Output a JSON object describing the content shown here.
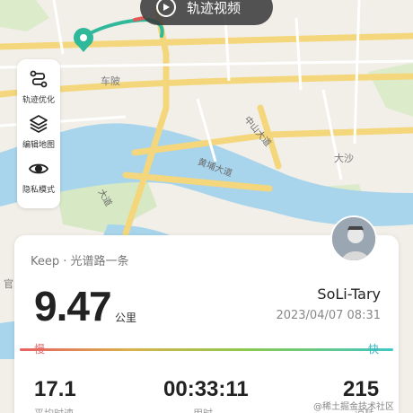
{
  "video_button": {
    "label": "轨迹视频",
    "icon": "play-icon"
  },
  "tools": [
    {
      "label": "轨迹优化",
      "icon": "route-optimize-icon"
    },
    {
      "label": "编辑地图",
      "icon": "layers-icon"
    },
    {
      "label": "隐私模式",
      "icon": "eye-icon"
    }
  ],
  "map": {
    "labels": {
      "chebei": "车陂",
      "dasha": "大沙",
      "huangpu_avenue": "黄埔大道",
      "zhongshan_avenue": "中山大道",
      "guan": "官",
      "misc_road": "大道"
    },
    "route_color": "#2fb89a"
  },
  "card": {
    "source": "Keep · 光谱路一条",
    "distance": "9.47",
    "distance_unit": "公里",
    "username": "SoLi-Tary",
    "datetime": "2023/04/07 08:31",
    "speed_slow": "慢",
    "speed_fast": "快",
    "stats": [
      {
        "value": "17.1",
        "label": "平均时速"
      },
      {
        "value": "00:33:11",
        "label": "用时"
      },
      {
        "value": "215",
        "label": "消耗"
      }
    ]
  },
  "watermark": "@稀土掘金技术社区",
  "colors": {
    "accent": "#2fb89a",
    "slow": "#e86060",
    "fast": "#3fc7c4"
  }
}
